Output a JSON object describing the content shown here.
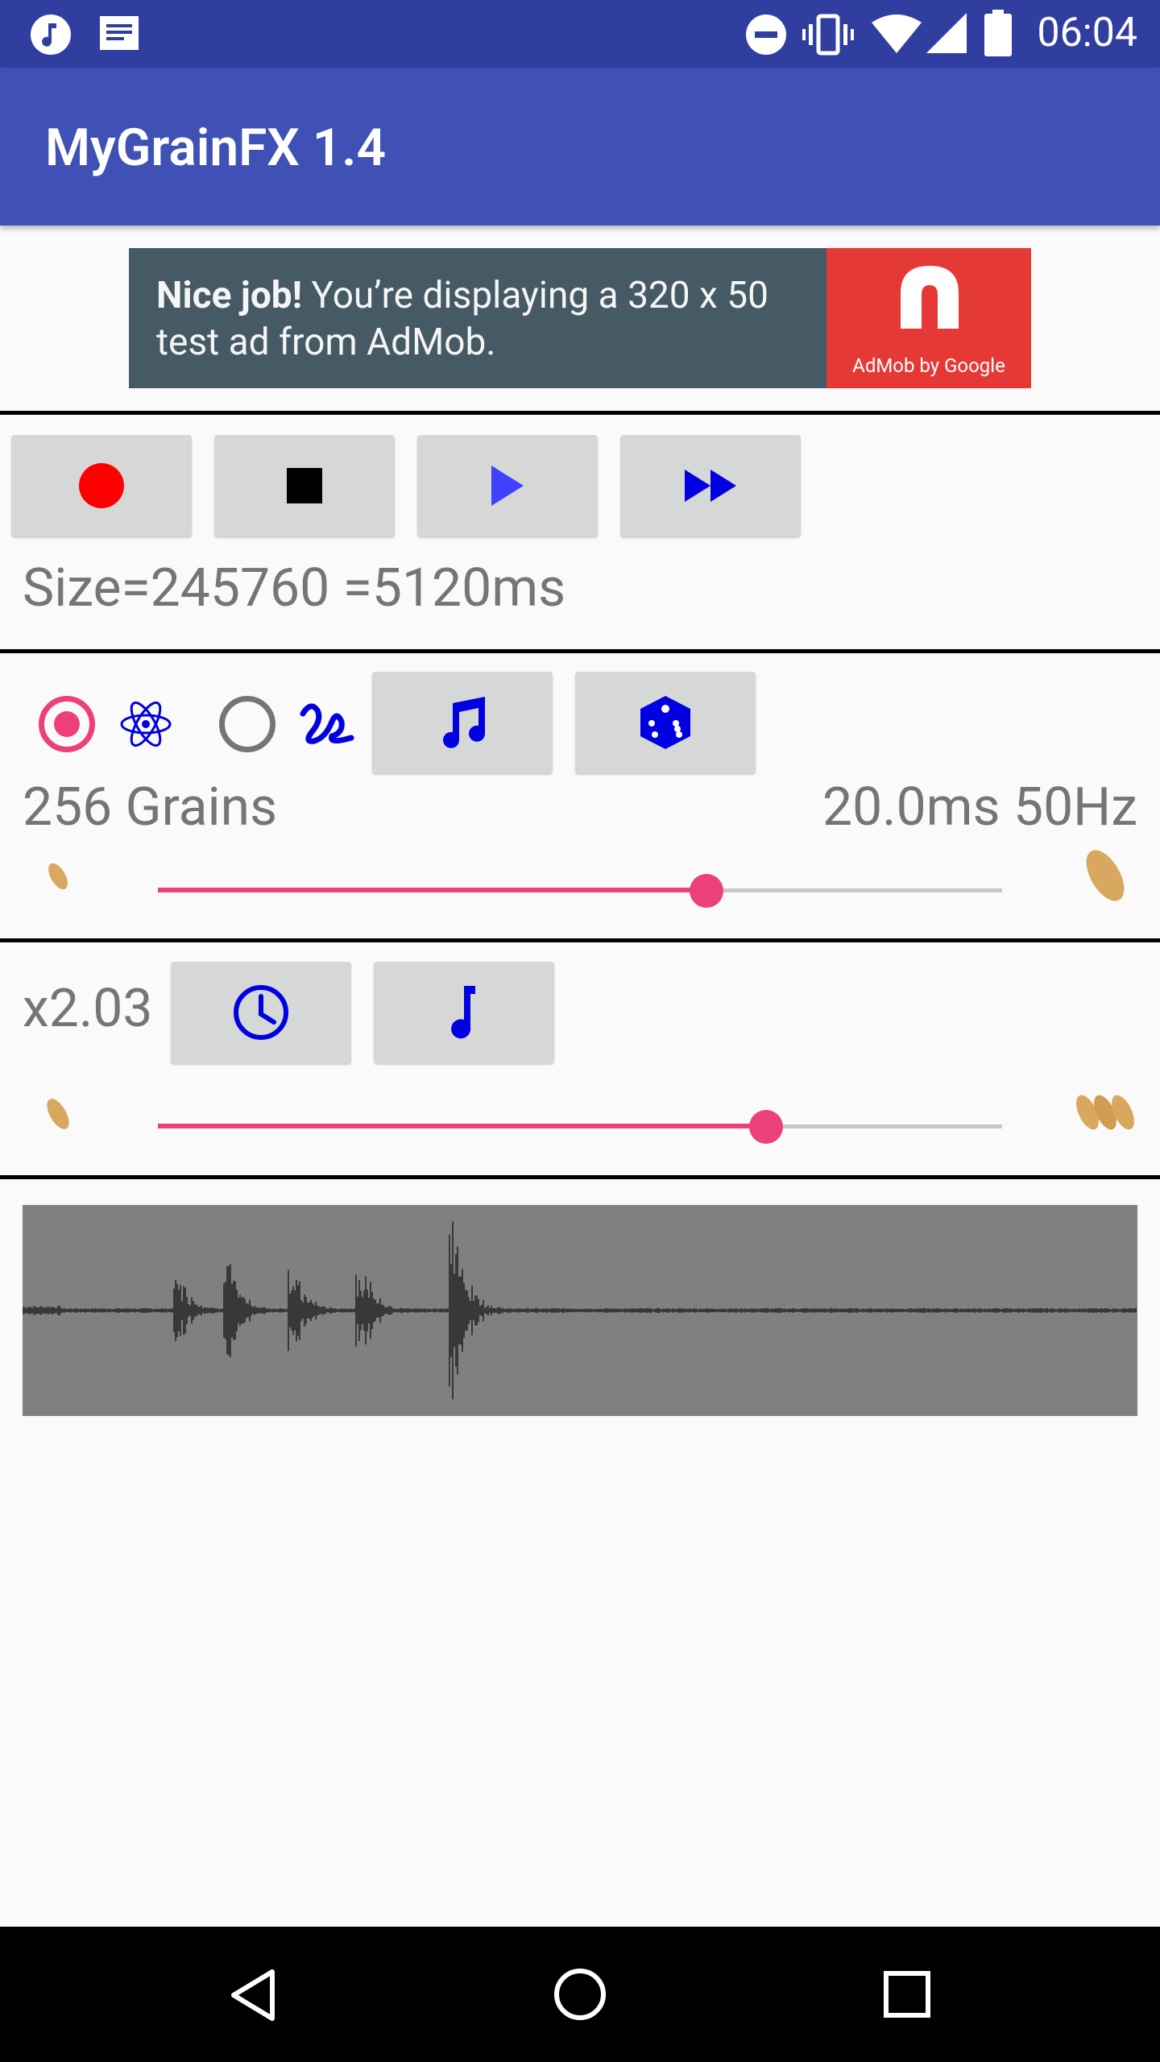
{
  "status_bar": {
    "time": "06:04",
    "left_icons": [
      "music-note-icon",
      "message-icon"
    ],
    "right_icons": [
      "do-not-disturb-icon",
      "vibrate-icon",
      "wifi-icon",
      "signal-icon",
      "battery-icon"
    ]
  },
  "app_bar": {
    "title": "MyGrainFX 1.4"
  },
  "ad": {
    "headline_bold": "Nice job!",
    "headline_rest": " You’re displaying a 320 x 50 test ad from AdMob.",
    "brand_caption": "AdMob by Google"
  },
  "transport": {
    "buttons": [
      "record-icon",
      "stop-icon",
      "play-icon",
      "fast-forward-icon"
    ],
    "size_label": "Size=245760 =5120ms"
  },
  "grains": {
    "mode_options": [
      {
        "icon": "atom-icon",
        "selected": true
      },
      {
        "icon": "squiggle-icon",
        "selected": false
      }
    ],
    "buttons": [
      "music-notes-icon",
      "dice-icon"
    ],
    "count_label": "256 Grains",
    "duration_label": "20.0ms 50Hz",
    "slider_value": 0.65,
    "colors": {
      "accent": "#ec407a",
      "icon_blue": "#0000e0"
    }
  },
  "speed": {
    "label": "x2.03",
    "buttons": [
      "clock-icon",
      "music-note-icon"
    ],
    "slider_value": 0.72
  },
  "waveform": {
    "background": "#808080"
  },
  "nav_bar": {
    "buttons": [
      "back-icon",
      "home-icon",
      "recents-icon"
    ]
  }
}
